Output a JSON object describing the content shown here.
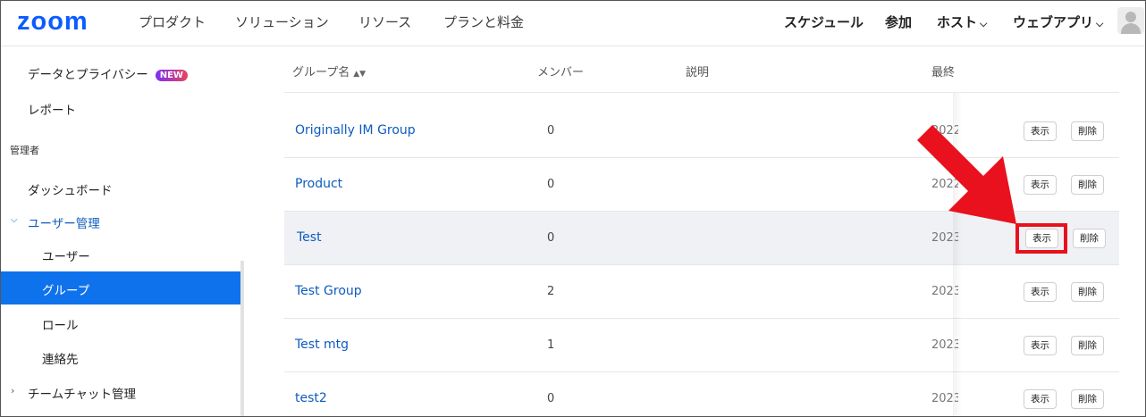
{
  "topnav": {
    "logo": "zoom",
    "items": [
      "プロダクト",
      "ソリューション",
      "リソース",
      "プランと料金"
    ],
    "right_items": [
      "スケジュール",
      "参加",
      "ホスト",
      "ウェブアプリ"
    ]
  },
  "sidebar": {
    "data_privacy": "データとプライバシー",
    "new_badge": "NEW",
    "reports": "レポート",
    "admin_section": "管理者",
    "dashboard": "ダッシュボード",
    "user_mgmt": "ユーザー管理",
    "users": "ユーザー",
    "groups": "グループ",
    "roles": "ロール",
    "contacts": "連絡先",
    "team_chat": "チームチャット管理"
  },
  "table": {
    "headers": {
      "name": "グループ名",
      "members": "メンバー",
      "description": "説明",
      "last": "最終"
    },
    "rows": [
      {
        "name": "Originally IM Group",
        "members": "0",
        "date": "2022",
        "view": "表示",
        "delete": "削除"
      },
      {
        "name": "Product",
        "members": "0",
        "date": "2022",
        "view": "表示",
        "delete": "削除"
      },
      {
        "name": "Test",
        "members": "0",
        "date": "2023",
        "view": "表示",
        "delete": "削除"
      },
      {
        "name": "Test Group",
        "members": "2",
        "date": "2023",
        "view": "表示",
        "delete": "削除"
      },
      {
        "name": "Test mtg",
        "members": "1",
        "date": "2023",
        "view": "表示",
        "delete": "削除"
      },
      {
        "name": "test2",
        "members": "0",
        "date": "2023",
        "view": "表示",
        "delete": "削除"
      }
    ]
  },
  "colors": {
    "brand": "#0b5cff",
    "active_bg": "#0e72ed",
    "link": "#0e5bbf",
    "annotation": "#e8111d"
  },
  "icons": [
    "sort-icon",
    "chevron-down-icon",
    "chevron-right-icon",
    "avatar-icon",
    "annotation-arrow"
  ]
}
